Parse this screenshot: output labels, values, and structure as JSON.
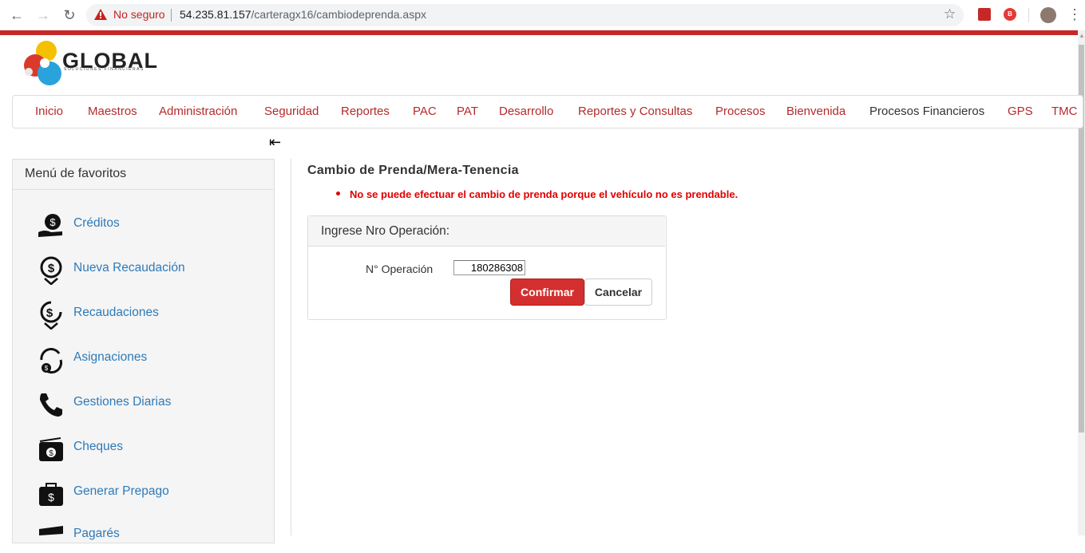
{
  "browser": {
    "security_label": "No seguro",
    "url_host": "54.235.81.157",
    "url_path": "/carteragx16/cambiodeprenda.aspx"
  },
  "logo": {
    "name": "GLOBAL",
    "tagline": "SOLUCIONES FINANCIERAS"
  },
  "menu": [
    {
      "label": "Inicio"
    },
    {
      "label": "Maestros"
    },
    {
      "label": "Administración"
    },
    {
      "label": "Seguridad"
    },
    {
      "label": "Reportes"
    },
    {
      "label": "PAC"
    },
    {
      "label": "PAT"
    },
    {
      "label": "Desarrollo"
    },
    {
      "label": "Reportes y Consultas"
    },
    {
      "label": "Procesos"
    },
    {
      "label": "Bienvenida"
    },
    {
      "label": "Procesos Financieros"
    },
    {
      "label": "GPS"
    },
    {
      "label": "TMC"
    }
  ],
  "favorites": {
    "title": "Menú de favoritos",
    "items": [
      {
        "label": "Créditos",
        "icon": "money-hand-icon"
      },
      {
        "label": "Nueva Recaudación",
        "icon": "money-pin-icon"
      },
      {
        "label": "Recaudaciones",
        "icon": "money-pin-icon"
      },
      {
        "label": "Asignaciones",
        "icon": "money-cycle-icon"
      },
      {
        "label": "Gestiones Diarias",
        "icon": "phone-icon"
      },
      {
        "label": "Cheques",
        "icon": "cash-stack-icon"
      },
      {
        "label": "Generar Prepago",
        "icon": "briefcase-money-icon"
      },
      {
        "label": "Pagarés",
        "icon": "bills-icon"
      }
    ]
  },
  "content": {
    "title": "Cambio de Prenda/Mera-Tenencia",
    "error": "No se puede efectuar el cambio de prenda porque el vehículo no es prendable.",
    "panel_title": "Ingrese Nro Operación:",
    "operation_label": "N° Operación",
    "operation_value": "180286308",
    "confirm_label": "Confirmar",
    "cancel_label": "Cancelar"
  },
  "colors": {
    "brand_red": "#c62828",
    "menu_text": "#b52a2a",
    "link_blue": "#2e7ab8",
    "error_red": "#e00000"
  }
}
